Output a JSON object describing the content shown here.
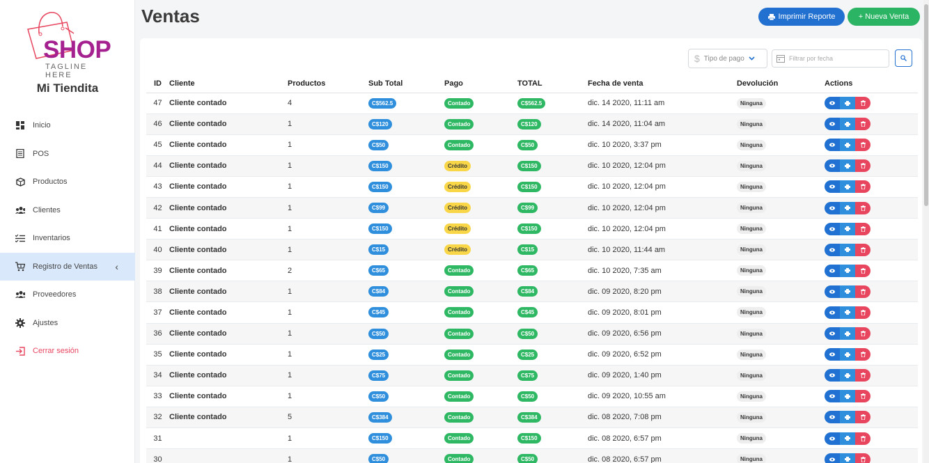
{
  "sidebar": {
    "logo": {
      "brand": "SHOP",
      "tagline": "TAGLINE HERE"
    },
    "store_name": "Mi Tiendita",
    "items": [
      {
        "label": "Inicio",
        "icon": "dashboard-icon"
      },
      {
        "label": "POS",
        "icon": "receipt-icon"
      },
      {
        "label": "Productos",
        "icon": "box-icon"
      },
      {
        "label": "Clientes",
        "icon": "users-icon"
      },
      {
        "label": "Inventarios",
        "icon": "checklist-icon"
      },
      {
        "label": "Registro de Ventas",
        "icon": "cart-icon"
      },
      {
        "label": "Proveedores",
        "icon": "users-icon"
      },
      {
        "label": "Ajustes",
        "icon": "gear-icon"
      },
      {
        "label": "Cerrar sesión",
        "icon": "logout-icon"
      }
    ]
  },
  "header": {
    "title": "Ventas",
    "print_label": "Imprimir Reporte",
    "new_label": "+ Nueva Venta"
  },
  "filters": {
    "payment_placeholder": "Tipo de pago",
    "date_placeholder": "Filtrar por fecha"
  },
  "table": {
    "columns": {
      "id": "ID",
      "cliente": "Cliente",
      "productos": "Productos",
      "subtotal": "Sub Total",
      "pago": "Pago",
      "total": "TOTAL",
      "fecha": "Fecha de venta",
      "devolucion": "Devolución",
      "actions": "Actions"
    },
    "rows": [
      {
        "id": "47",
        "cliente": "Cliente contado",
        "productos": "4",
        "subtotal": "C$562.5",
        "pago": "Contado",
        "total": "C$562.5",
        "fecha": "dic. 14 2020, 11:11 am",
        "devolucion": "Ninguna"
      },
      {
        "id": "46",
        "cliente": "Cliente contado",
        "productos": "1",
        "subtotal": "C$120",
        "pago": "Contado",
        "total": "C$120",
        "fecha": "dic. 14 2020, 11:04 am",
        "devolucion": "Ninguna"
      },
      {
        "id": "45",
        "cliente": "Cliente contado",
        "productos": "1",
        "subtotal": "C$50",
        "pago": "Contado",
        "total": "C$50",
        "fecha": "dic. 10 2020, 3:37 pm",
        "devolucion": "Ninguna"
      },
      {
        "id": "44",
        "cliente": "Cliente contado",
        "productos": "1",
        "subtotal": "C$150",
        "pago": "Crédito",
        "total": "C$150",
        "fecha": "dic. 10 2020, 12:04 pm",
        "devolucion": "Ninguna"
      },
      {
        "id": "43",
        "cliente": "Cliente contado",
        "productos": "1",
        "subtotal": "C$150",
        "pago": "Crédito",
        "total": "C$150",
        "fecha": "dic. 10 2020, 12:04 pm",
        "devolucion": "Ninguna"
      },
      {
        "id": "42",
        "cliente": "Cliente contado",
        "productos": "1",
        "subtotal": "C$99",
        "pago": "Crédito",
        "total": "C$99",
        "fecha": "dic. 10 2020, 12:04 pm",
        "devolucion": "Ninguna"
      },
      {
        "id": "41",
        "cliente": "Cliente contado",
        "productos": "1",
        "subtotal": "C$150",
        "pago": "Crédito",
        "total": "C$150",
        "fecha": "dic. 10 2020, 12:04 pm",
        "devolucion": "Ninguna"
      },
      {
        "id": "40",
        "cliente": "Cliente contado",
        "productos": "1",
        "subtotal": "C$15",
        "pago": "Crédito",
        "total": "C$15",
        "fecha": "dic. 10 2020, 11:44 am",
        "devolucion": "Ninguna"
      },
      {
        "id": "39",
        "cliente": "Cliente contado",
        "productos": "2",
        "subtotal": "C$65",
        "pago": "Contado",
        "total": "C$65",
        "fecha": "dic. 10 2020, 7:35 am",
        "devolucion": "Ninguna"
      },
      {
        "id": "38",
        "cliente": "Cliente contado",
        "productos": "1",
        "subtotal": "C$84",
        "pago": "Contado",
        "total": "C$84",
        "fecha": "dic. 09 2020, 8:20 pm",
        "devolucion": "Ninguna"
      },
      {
        "id": "37",
        "cliente": "Cliente contado",
        "productos": "1",
        "subtotal": "C$45",
        "pago": "Contado",
        "total": "C$45",
        "fecha": "dic. 09 2020, 8:01 pm",
        "devolucion": "Ninguna"
      },
      {
        "id": "36",
        "cliente": "Cliente contado",
        "productos": "1",
        "subtotal": "C$50",
        "pago": "Contado",
        "total": "C$50",
        "fecha": "dic. 09 2020, 6:56 pm",
        "devolucion": "Ninguna"
      },
      {
        "id": "35",
        "cliente": "Cliente contado",
        "productos": "1",
        "subtotal": "C$25",
        "pago": "Contado",
        "total": "C$25",
        "fecha": "dic. 09 2020, 6:52 pm",
        "devolucion": "Ninguna"
      },
      {
        "id": "34",
        "cliente": "Cliente contado",
        "productos": "1",
        "subtotal": "C$75",
        "pago": "Contado",
        "total": "C$75",
        "fecha": "dic. 09 2020, 1:40 pm",
        "devolucion": "Ninguna"
      },
      {
        "id": "33",
        "cliente": "Cliente contado",
        "productos": "1",
        "subtotal": "C$50",
        "pago": "Contado",
        "total": "C$50",
        "fecha": "dic. 09 2020, 10:55 am",
        "devolucion": "Ninguna"
      },
      {
        "id": "32",
        "cliente": "Cliente contado",
        "productos": "5",
        "subtotal": "C$384",
        "pago": "Contado",
        "total": "C$384",
        "fecha": "dic. 08 2020, 7:08 pm",
        "devolucion": "Ninguna"
      },
      {
        "id": "31",
        "cliente": "",
        "productos": "1",
        "subtotal": "C$150",
        "pago": "Contado",
        "total": "C$150",
        "fecha": "dic. 08 2020, 6:57 pm",
        "devolucion": "Ninguna"
      },
      {
        "id": "30",
        "cliente": "",
        "productos": "1",
        "subtotal": "C$50",
        "pago": "Contado",
        "total": "C$50",
        "fecha": "dic. 08 2020, 6:57 pm",
        "devolucion": "Ninguna"
      }
    ]
  },
  "colors": {
    "primary": "#2271d1",
    "success": "#2ab463",
    "danger": "#e8455e",
    "warning": "#f8d648",
    "brand": "#a4218f"
  }
}
